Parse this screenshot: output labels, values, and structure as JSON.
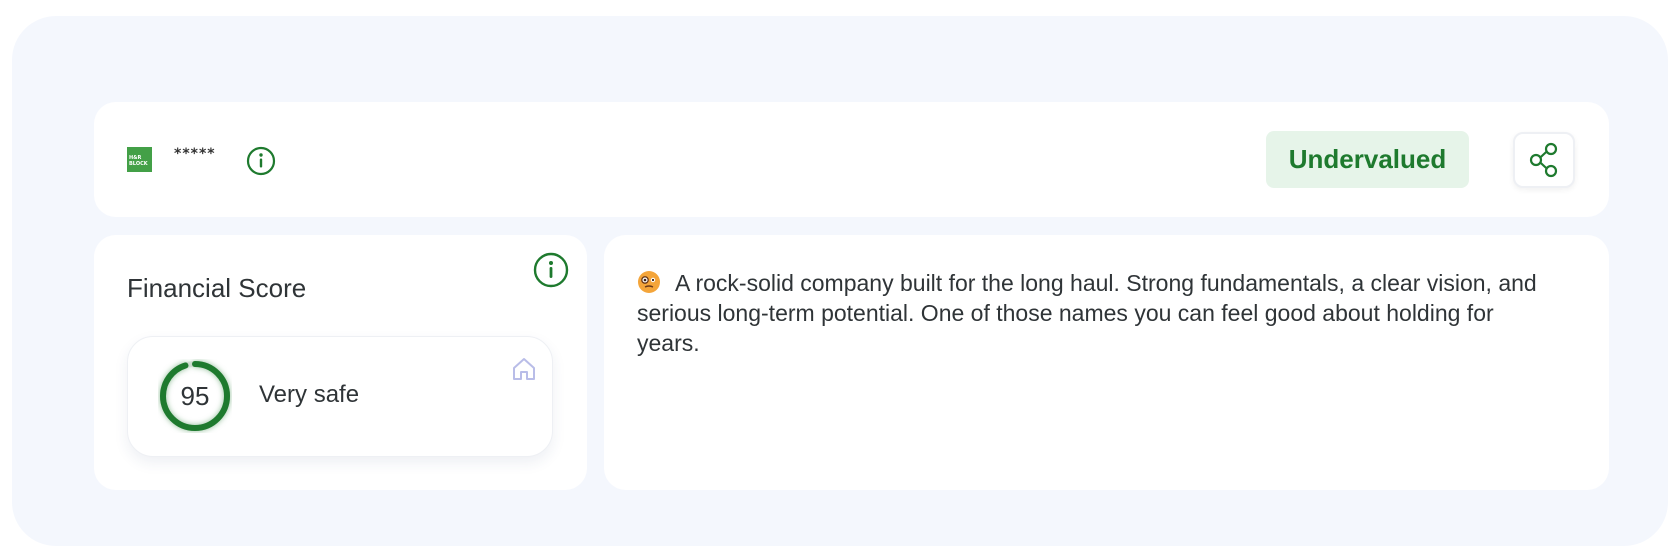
{
  "header": {
    "logo_text": "H&R BLOCK",
    "ticker": "*****",
    "valuation_badge": "Undervalued",
    "colors": {
      "accent": "#1e7a2e",
      "badge_bg": "#e6f4e9",
      "logo_bg": "#43a047"
    }
  },
  "score": {
    "title": "Financial Score",
    "value": "95",
    "value_fraction": 0.95,
    "label": "Very safe"
  },
  "description": {
    "emoji_icon": "monocle-face-icon",
    "text": "A rock-solid company built for the long haul. Strong fundamentals, a clear vision, and serious long-term potential. One of those names you can feel good about holding for years."
  },
  "icons": [
    "info-icon",
    "share-icon",
    "home-icon",
    "monocle-face-icon"
  ]
}
